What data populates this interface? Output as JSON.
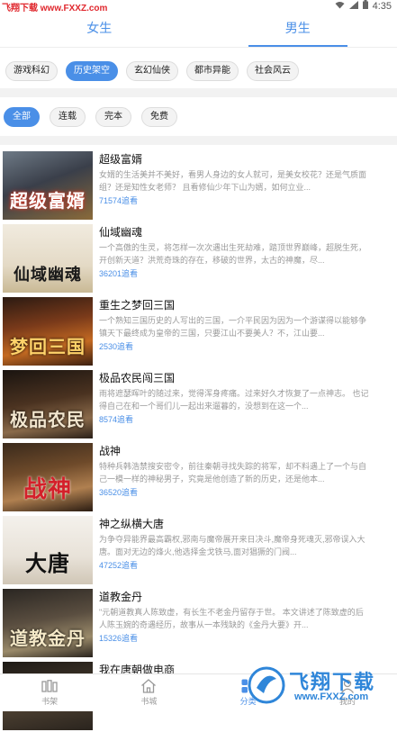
{
  "status_bar": {
    "watermark": "飞翔下载 www.FXXZ.com",
    "time": "4:35"
  },
  "gender_tabs": [
    {
      "label": "女生",
      "active": false
    },
    {
      "label": "男生",
      "active": true
    }
  ],
  "genres": [
    {
      "label": "游戏科幻",
      "active": false
    },
    {
      "label": "历史架空",
      "active": true
    },
    {
      "label": "玄幻仙侠",
      "active": false
    },
    {
      "label": "都市异能",
      "active": false
    },
    {
      "label": "社会风云",
      "active": false
    }
  ],
  "filters": [
    {
      "label": "全部",
      "active": true
    },
    {
      "label": "连载",
      "active": false
    },
    {
      "label": "完本",
      "active": false
    },
    {
      "label": "免费",
      "active": false
    }
  ],
  "books": [
    {
      "title": "超级富婿",
      "cover_text": "超级富婿",
      "desc": "女婿的生活美并不美好，看男人身边的女人就可，是美女校花？还是气质面组？还是知性女老师？ 且看修仙少年下山为婿，如何立业...",
      "stat": "71574追看"
    },
    {
      "title": "仙域幽魂",
      "cover_text": "仙域幽魂",
      "desc": "一个高傲的生灵，将怎样一次次遇出生死劫难，踏顶世界巅峰，超脱生死，开创新天道？洪荒奇珠的存在，移破的世界，太古的神魔，尽...",
      "stat": "36201追看"
    },
    {
      "title": "重生之梦回三国",
      "cover_text": "梦回三国",
      "desc": "一个熟知三国历史的人写出的三国，一介平民因为因为一个游谋得以能够争镇天下最终成为皇帝的三国，只要江山不要美人？不，江山要...",
      "stat": "2530追看"
    },
    {
      "title": "极品农民闯三国",
      "cover_text": "极品农民",
      "desc": "雨将遮瑟晖叶的随过来，觉得浑身疼痛。过来好久才恢复了一点神志。 也记得自己在和一个哥们儿一起出来遛暮的，没想到在这一个...",
      "stat": "8574追看"
    },
    {
      "title": "战神",
      "cover_text": "战神",
      "desc": "特种兵韩浩禁搜安密令，前往秦朝寻找失踪的将军，却不料遇上了一个与自己一模一样的神秘男子，究竟是他创造了新的历史，还是他本...",
      "stat": "36520追看"
    },
    {
      "title": "神之纵横大唐",
      "cover_text": "大唐",
      "desc": "为争夺异能界最高霸权,邪南与魔帝展开来日决斗,魔帝身死魂灭,邪帝误入大唐。面对无边的烽火,他选择金戈铁马,面对猖獗的门阀...",
      "stat": "47252追看"
    },
    {
      "title": "道教金丹",
      "cover_text": "道教金丹",
      "desc": "\"元朝道教真人陈致虚，有长生不老金丹留存于世。 本文讲述了陈致虚的后人陈玉婉的奇遇经历，故事从一本残缺的《金丹大要》开...",
      "stat": "15326追看"
    },
    {
      "title": "我在唐朝做电商",
      "cover_text": "",
      "desc": "",
      "stat": ""
    }
  ],
  "bottom_nav": [
    {
      "label": "书架",
      "icon": "bookshelf-icon",
      "active": false
    },
    {
      "label": "书城",
      "icon": "home-icon",
      "active": false
    },
    {
      "label": "分类",
      "icon": "category-icon",
      "active": true
    },
    {
      "label": "我的",
      "icon": "profile-icon",
      "active": false
    }
  ],
  "brand_watermark": {
    "line1": "飞翔下载",
    "line2": "www.FXXZ.com"
  },
  "colors": {
    "accent": "#4a8fe7",
    "desc": "#9a9a9a",
    "band": "#f2f2f2"
  }
}
